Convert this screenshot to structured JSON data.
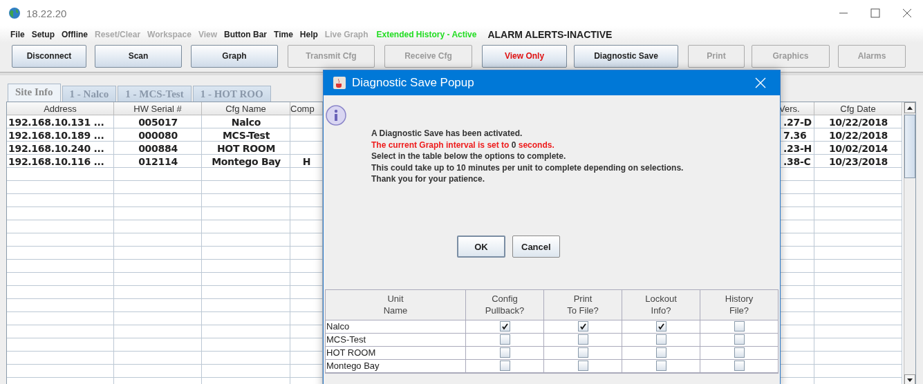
{
  "window": {
    "title": "18.22.20"
  },
  "menu": [
    {
      "label": "File",
      "kind": "menu",
      "disabled": false
    },
    {
      "label": "Setup",
      "kind": "menu",
      "disabled": false
    },
    {
      "label": "Offline",
      "kind": "menu",
      "disabled": false
    },
    {
      "label": "Reset/Clear",
      "kind": "menu",
      "disabled": true
    },
    {
      "label": "Workspace",
      "kind": "menu",
      "disabled": true
    },
    {
      "label": "View",
      "kind": "menu",
      "disabled": true
    },
    {
      "label": "Button Bar",
      "kind": "menu",
      "disabled": false
    },
    {
      "label": "Time",
      "kind": "menu",
      "disabled": false
    },
    {
      "label": "Help",
      "kind": "menu",
      "disabled": false
    },
    {
      "label": "Live Graph",
      "kind": "menu",
      "disabled": true
    },
    {
      "label": "Extended History - Active",
      "kind": "status-ok"
    },
    {
      "label": "ALARM ALERTS-INACTIVE",
      "kind": "status-alarm"
    }
  ],
  "toolbar": [
    {
      "label": "Disconnect",
      "disabled": false,
      "kind": "normal"
    },
    {
      "label": "Scan",
      "disabled": false,
      "kind": "normal"
    },
    {
      "label": "Graph",
      "disabled": false,
      "kind": "normal"
    },
    {
      "label": "Transmit Cfg",
      "disabled": true,
      "kind": "normal"
    },
    {
      "label": "Receive Cfg",
      "disabled": true,
      "kind": "normal"
    },
    {
      "label": "View Only",
      "disabled": false,
      "kind": "alert"
    },
    {
      "label": "Diagnostic Save",
      "disabled": false,
      "kind": "normal"
    },
    {
      "label": "Print",
      "disabled": true,
      "kind": "normal"
    },
    {
      "label": "Graphics",
      "disabled": true,
      "kind": "normal"
    },
    {
      "label": "Alarms",
      "disabled": true,
      "kind": "normal"
    }
  ],
  "tabs": [
    {
      "label": "Site Info",
      "selected": true
    },
    {
      "label": "1 - Nalco",
      "selected": false
    },
    {
      "label": "1 - MCS-Test",
      "selected": false
    },
    {
      "label": "1 - HOT ROO",
      "selected": false
    }
  ],
  "table": {
    "columns": [
      "Address",
      "HW Serial #",
      "Cfg Name",
      "Comp",
      "Vers.",
      "Cfg Date"
    ],
    "rows": [
      {
        "address": "192.168.10.131 ...",
        "hw_serial": "005017",
        "cfg_name": "Nalco",
        "version": ".27-D",
        "cfg_date": "10/22/2018"
      },
      {
        "address": "192.168.10.189 ...",
        "hw_serial": "000080",
        "cfg_name": "MCS-Test",
        "version": "7.36",
        "cfg_date": "10/22/2018"
      },
      {
        "address": "192.168.10.240 ...",
        "hw_serial": "000884",
        "cfg_name": "HOT ROOM",
        "version": ".23-H",
        "cfg_date": "10/02/2014"
      },
      {
        "address": "192.168.10.116 ...",
        "hw_serial": "012114",
        "cfg_name": "Montego Bay",
        "column_4": "H",
        "version": ".38-C",
        "cfg_date": "10/23/2018"
      }
    ]
  },
  "dialog": {
    "title": "Diagnostic Save Popup",
    "message": [
      {
        "segments": [
          {
            "text": "A Diagnostic Save has been activated.",
            "kind": "normal"
          }
        ]
      },
      {
        "segments": [
          {
            "text": "The current Graph interval is set to ",
            "kind": "alert"
          },
          {
            "text": "0",
            "kind": "normal"
          },
          {
            "text": " seconds.",
            "kind": "alert"
          }
        ]
      },
      {
        "segments": [
          {
            "text": "Select in the table below the options to complete.",
            "kind": "normal"
          }
        ]
      },
      {
        "segments": [
          {
            "text": "This could take up to 10 minutes per unit to complete depending on selections.",
            "kind": "normal"
          }
        ]
      },
      {
        "segments": [
          {
            "text": "Thank you for your patience.",
            "kind": "normal"
          }
        ]
      }
    ],
    "buttons": [
      "OK",
      "Cancel"
    ],
    "options": {
      "columns": [
        [
          "Unit",
          "Name"
        ],
        [
          "Config",
          "Pullback?"
        ],
        [
          "Print",
          "To File?"
        ],
        [
          "Lockout",
          "Info?"
        ],
        [
          "History",
          "File?"
        ]
      ],
      "rows": [
        {
          "unit": "Nalco",
          "checks": [
            true,
            true,
            true,
            false
          ]
        },
        {
          "unit": "MCS-Test",
          "checks": [
            false,
            false,
            false,
            false
          ]
        },
        {
          "unit": "HOT ROOM",
          "checks": [
            false,
            false,
            false,
            false
          ]
        },
        {
          "unit": "Montego Bay",
          "checks": [
            false,
            false,
            false,
            false
          ]
        }
      ]
    }
  }
}
